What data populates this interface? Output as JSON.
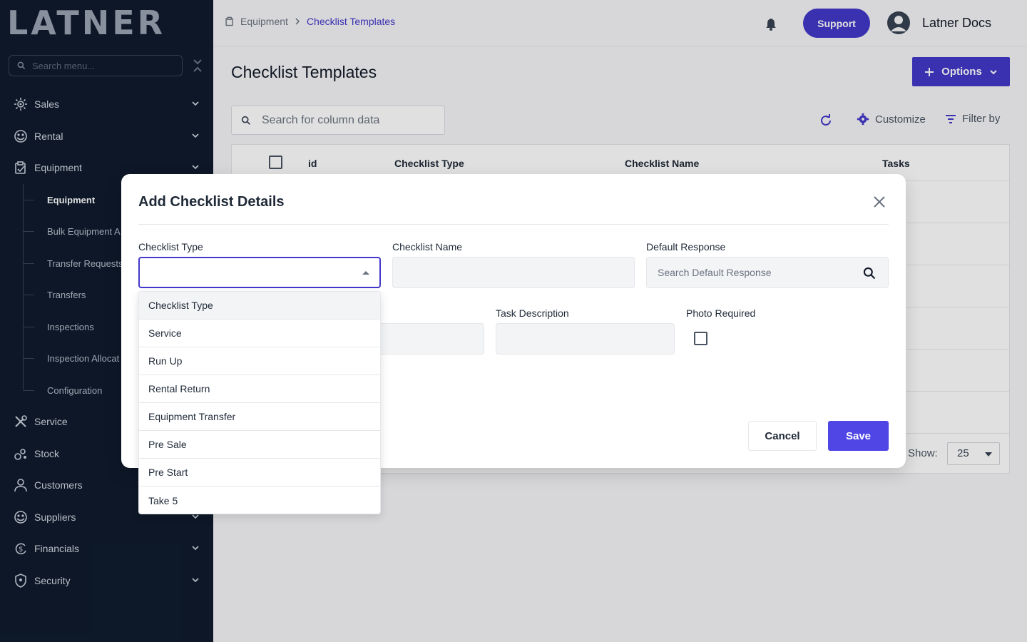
{
  "sidebar": {
    "logo": "LATNER",
    "search_placeholder": "Search menu...",
    "items": [
      {
        "label": "Sales",
        "icon": "sales-icon"
      },
      {
        "label": "Rental",
        "icon": "rental-icon"
      },
      {
        "label": "Equipment",
        "icon": "equipment-icon"
      },
      {
        "label": "Service",
        "icon": "service-icon"
      },
      {
        "label": "Stock",
        "icon": "stock-icon"
      },
      {
        "label": "Customers",
        "icon": "customers-icon"
      },
      {
        "label": "Suppliers",
        "icon": "suppliers-icon"
      },
      {
        "label": "Financials",
        "icon": "financials-icon"
      },
      {
        "label": "Security",
        "icon": "security-icon"
      }
    ],
    "equipment_sub": [
      "Equipment",
      "Bulk Equipment A",
      "Transfer Requests",
      "Transfers",
      "Inspections",
      "Inspection Allocat",
      "Configuration"
    ]
  },
  "header": {
    "breadcrumb": [
      "Equipment",
      "Checklist Templates"
    ],
    "support_label": "Support",
    "user_name": "Latner Docs"
  },
  "page": {
    "title": "Checklist Templates",
    "options_label": "Options",
    "search_placeholder": "Search for column data",
    "customize_label": "Customize",
    "filter_label": "Filter by",
    "columns": [
      "id",
      "Checklist Type",
      "Checklist Name",
      "Tasks"
    ],
    "show_label": "Show:",
    "show_value": "25"
  },
  "modal": {
    "title": "Add Checklist Details",
    "checklist_type_label": "Checklist Type",
    "checklist_name_label": "Checklist Name",
    "default_response_label": "Default Response",
    "default_response_placeholder": "Search Default Response",
    "task_description_label": "Task Description",
    "photo_required_label": "Photo Required",
    "cancel_label": "Cancel",
    "save_label": "Save"
  },
  "dropdown": {
    "options": [
      "Checklist Type",
      "Service",
      "Run Up",
      "Rental Return",
      "Equipment Transfer",
      "Pre Sale",
      "Pre Start",
      "Take 5"
    ]
  },
  "colors": {
    "accent": "#4338ca",
    "sidebar_bg": "#0f1b2d"
  }
}
